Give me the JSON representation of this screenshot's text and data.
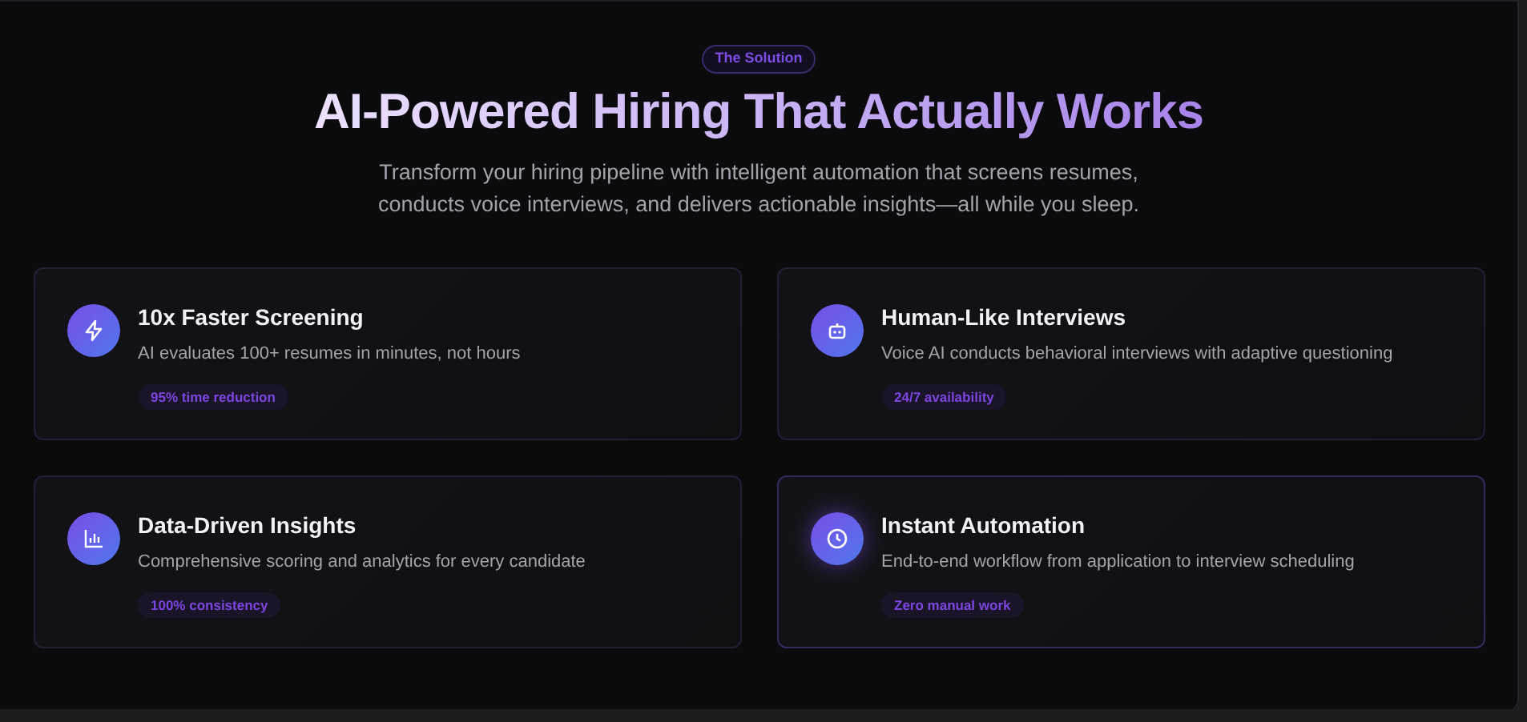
{
  "eyebrow": "The Solution",
  "heading": "AI-Powered Hiring That Actually Works",
  "subheading": "Transform your hiring pipeline with intelligent automation that screens resumes, conducts voice interviews, and delivers actionable insights—all while you sleep.",
  "features": [
    {
      "title": "10x Faster Screening",
      "description": "AI evaluates 100+ resumes in minutes, not hours",
      "tag": "95% time reduction",
      "highlighted": false
    },
    {
      "title": "Human-Like Interviews",
      "description": "Voice AI conducts behavioral interviews with adaptive questioning",
      "tag": "24/7 availability",
      "highlighted": false
    },
    {
      "title": "Data-Driven Insights",
      "description": "Comprehensive scoring and analytics for every candidate",
      "tag": "100% consistency",
      "highlighted": false
    },
    {
      "title": "Instant Automation",
      "description": "End-to-end workflow from application to interview scheduling",
      "tag": "Zero manual work",
      "highlighted": true
    }
  ]
}
